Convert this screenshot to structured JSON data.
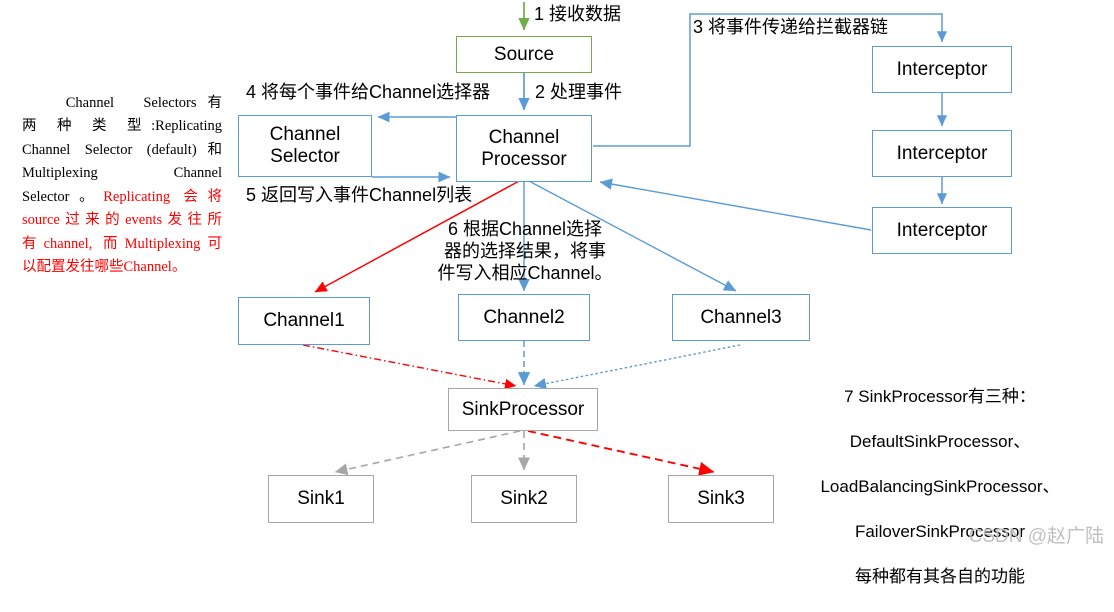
{
  "meta": {
    "title": "Flume Source / Channel / Sink 数据流程图",
    "watermark": "CSDN @赵广陆",
    "colors": {
      "blue": "#5B9BD5",
      "green": "#70AD47",
      "gray": "#A6A6A6",
      "red": "#FF0000",
      "text": "#000000",
      "watermark": "#BFBFBF"
    }
  },
  "nodes": {
    "source": "Source",
    "channel_selector": "Channel\nSelector",
    "channel_processor": "Channel\nProcessor",
    "interceptor1": "Interceptor",
    "interceptor2": "Interceptor",
    "interceptor3": "Interceptor",
    "channel1": "Channel1",
    "channel2": "Channel2",
    "channel3": "Channel3",
    "sink_processor": "SinkProcessor",
    "sink1": "Sink1",
    "sink2": "Sink2",
    "sink3": "Sink3"
  },
  "edge_labels": {
    "step1": "1 接收数据",
    "step2": "2 处理事件",
    "step3": "3 将事件传递给拦截器链",
    "step4": "4 将每个事件给Channel选择器",
    "step5": "5 返回写入事件Channel列表",
    "step6": "6 根据Channel选择\n器的选择结果，将事\n件写入相应Channel。"
  },
  "left_note": {
    "lines": [
      {
        "text": "　　Channel　Selectors 有",
        "color": "black"
      },
      {
        "text": "两　种　类　型 :Replicating",
        "color": "black"
      },
      {
        "text": "Channel  Selector  (default)和",
        "color": "black"
      },
      {
        "text": "Multiplexing　　　　Channel",
        "color": "black"
      },
      {
        "text": "Selector。",
        "color": "black",
        "trailing": "Replicating 会将",
        "trailing_color": "red"
      },
      {
        "text": "source过来的events发往所",
        "color": "red"
      },
      {
        "text": "有channel, 而Multiplexing可",
        "color": "red"
      },
      {
        "text": "以配置发往哪些Channel。",
        "color": "red"
      }
    ],
    "plain_text": "Channel Selectors 有两种类型:Replicating Channel Selector (default)和Multiplexing Channel Selector。Replicating 会将source过来的events发往所有channel, 而Multiplexing可以配置发往哪些Channel。"
  },
  "right_note": {
    "lines": [
      "7 SinkProcessor有三种：",
      "DefaultSinkProcessor、",
      "LoadBalancingSinkProcessor、",
      "FailoverSinkProcessor",
      "每种都有其各自的功能"
    ]
  }
}
